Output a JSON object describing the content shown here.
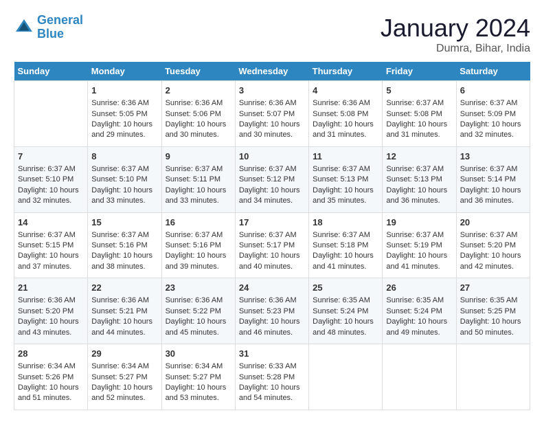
{
  "logo": {
    "line1": "General",
    "line2": "Blue"
  },
  "title": "January 2024",
  "subtitle": "Dumra, Bihar, India",
  "days_header": [
    "Sunday",
    "Monday",
    "Tuesday",
    "Wednesday",
    "Thursday",
    "Friday",
    "Saturday"
  ],
  "weeks": [
    [
      {
        "day": "",
        "content": ""
      },
      {
        "day": "1",
        "content": "Sunrise: 6:36 AM\nSunset: 5:05 PM\nDaylight: 10 hours\nand 29 minutes."
      },
      {
        "day": "2",
        "content": "Sunrise: 6:36 AM\nSunset: 5:06 PM\nDaylight: 10 hours\nand 30 minutes."
      },
      {
        "day": "3",
        "content": "Sunrise: 6:36 AM\nSunset: 5:07 PM\nDaylight: 10 hours\nand 30 minutes."
      },
      {
        "day": "4",
        "content": "Sunrise: 6:36 AM\nSunset: 5:08 PM\nDaylight: 10 hours\nand 31 minutes."
      },
      {
        "day": "5",
        "content": "Sunrise: 6:37 AM\nSunset: 5:08 PM\nDaylight: 10 hours\nand 31 minutes."
      },
      {
        "day": "6",
        "content": "Sunrise: 6:37 AM\nSunset: 5:09 PM\nDaylight: 10 hours\nand 32 minutes."
      }
    ],
    [
      {
        "day": "7",
        "content": "Sunrise: 6:37 AM\nSunset: 5:10 PM\nDaylight: 10 hours\nand 32 minutes."
      },
      {
        "day": "8",
        "content": "Sunrise: 6:37 AM\nSunset: 5:10 PM\nDaylight: 10 hours\nand 33 minutes."
      },
      {
        "day": "9",
        "content": "Sunrise: 6:37 AM\nSunset: 5:11 PM\nDaylight: 10 hours\nand 33 minutes."
      },
      {
        "day": "10",
        "content": "Sunrise: 6:37 AM\nSunset: 5:12 PM\nDaylight: 10 hours\nand 34 minutes."
      },
      {
        "day": "11",
        "content": "Sunrise: 6:37 AM\nSunset: 5:13 PM\nDaylight: 10 hours\nand 35 minutes."
      },
      {
        "day": "12",
        "content": "Sunrise: 6:37 AM\nSunset: 5:13 PM\nDaylight: 10 hours\nand 36 minutes."
      },
      {
        "day": "13",
        "content": "Sunrise: 6:37 AM\nSunset: 5:14 PM\nDaylight: 10 hours\nand 36 minutes."
      }
    ],
    [
      {
        "day": "14",
        "content": "Sunrise: 6:37 AM\nSunset: 5:15 PM\nDaylight: 10 hours\nand 37 minutes."
      },
      {
        "day": "15",
        "content": "Sunrise: 6:37 AM\nSunset: 5:16 PM\nDaylight: 10 hours\nand 38 minutes."
      },
      {
        "day": "16",
        "content": "Sunrise: 6:37 AM\nSunset: 5:16 PM\nDaylight: 10 hours\nand 39 minutes."
      },
      {
        "day": "17",
        "content": "Sunrise: 6:37 AM\nSunset: 5:17 PM\nDaylight: 10 hours\nand 40 minutes."
      },
      {
        "day": "18",
        "content": "Sunrise: 6:37 AM\nSunset: 5:18 PM\nDaylight: 10 hours\nand 41 minutes."
      },
      {
        "day": "19",
        "content": "Sunrise: 6:37 AM\nSunset: 5:19 PM\nDaylight: 10 hours\nand 41 minutes."
      },
      {
        "day": "20",
        "content": "Sunrise: 6:37 AM\nSunset: 5:20 PM\nDaylight: 10 hours\nand 42 minutes."
      }
    ],
    [
      {
        "day": "21",
        "content": "Sunrise: 6:36 AM\nSunset: 5:20 PM\nDaylight: 10 hours\nand 43 minutes."
      },
      {
        "day": "22",
        "content": "Sunrise: 6:36 AM\nSunset: 5:21 PM\nDaylight: 10 hours\nand 44 minutes."
      },
      {
        "day": "23",
        "content": "Sunrise: 6:36 AM\nSunset: 5:22 PM\nDaylight: 10 hours\nand 45 minutes."
      },
      {
        "day": "24",
        "content": "Sunrise: 6:36 AM\nSunset: 5:23 PM\nDaylight: 10 hours\nand 46 minutes."
      },
      {
        "day": "25",
        "content": "Sunrise: 6:35 AM\nSunset: 5:24 PM\nDaylight: 10 hours\nand 48 minutes."
      },
      {
        "day": "26",
        "content": "Sunrise: 6:35 AM\nSunset: 5:24 PM\nDaylight: 10 hours\nand 49 minutes."
      },
      {
        "day": "27",
        "content": "Sunrise: 6:35 AM\nSunset: 5:25 PM\nDaylight: 10 hours\nand 50 minutes."
      }
    ],
    [
      {
        "day": "28",
        "content": "Sunrise: 6:34 AM\nSunset: 5:26 PM\nDaylight: 10 hours\nand 51 minutes."
      },
      {
        "day": "29",
        "content": "Sunrise: 6:34 AM\nSunset: 5:27 PM\nDaylight: 10 hours\nand 52 minutes."
      },
      {
        "day": "30",
        "content": "Sunrise: 6:34 AM\nSunset: 5:27 PM\nDaylight: 10 hours\nand 53 minutes."
      },
      {
        "day": "31",
        "content": "Sunrise: 6:33 AM\nSunset: 5:28 PM\nDaylight: 10 hours\nand 54 minutes."
      },
      {
        "day": "",
        "content": ""
      },
      {
        "day": "",
        "content": ""
      },
      {
        "day": "",
        "content": ""
      }
    ]
  ]
}
